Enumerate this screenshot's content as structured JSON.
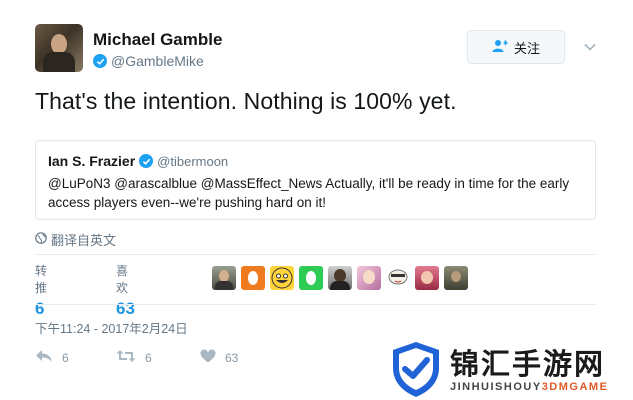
{
  "author": {
    "name": "Michael Gamble",
    "handle": "@GambleMike"
  },
  "follow_button": {
    "label": "关注",
    "icon": "add-user-icon"
  },
  "tweet": {
    "text": "That's the intention. Nothing is 100% yet."
  },
  "quoted_tweet": {
    "name": "Ian S. Frazier",
    "handle": "@tibermoon",
    "text": "@LuPoN3 @arascalblue @MassEffect_News Actually, it'll be ready in time for the early access players even--we're pushing hard on it!"
  },
  "translate": {
    "label": "翻译自英文",
    "icon": "globe-icon"
  },
  "stats": {
    "retweets": {
      "label": "转推",
      "value": "6"
    },
    "likes": {
      "label": "喜欢",
      "value": "63"
    }
  },
  "timestamp": "下午11:24 - 2017年2月24日",
  "actions": {
    "reply": {
      "count": "6",
      "icon": "reply-icon"
    },
    "retweet": {
      "count": "6",
      "icon": "retweet-icon"
    },
    "like": {
      "count": "63",
      "icon": "heart-icon"
    }
  },
  "watermark": {
    "cn": "锦汇手游网",
    "en_prefix": "JINHUISHOUY",
    "en_highlight": "3DMGAME"
  },
  "colors": {
    "accent": "#1da1f2",
    "stat_value": "#1b95e0",
    "muted": "#657786"
  }
}
